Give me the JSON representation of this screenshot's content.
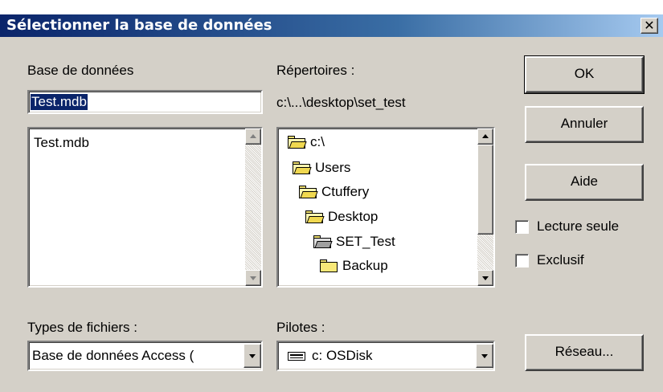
{
  "dialog": {
    "title": "Sélectionner la base de données",
    "close_glyph": "✕"
  },
  "database": {
    "label": "Base de données",
    "value": "Test.mdb",
    "files": [
      "Test.mdb"
    ]
  },
  "directories": {
    "label": "Répertoires :",
    "current_path": "c:\\...\\desktop\\set_test",
    "tree": [
      {
        "name": "c:\\",
        "icon": "open-folder-icon"
      },
      {
        "name": "Users",
        "icon": "open-folder-icon"
      },
      {
        "name": "Ctuffery",
        "icon": "open-folder-icon"
      },
      {
        "name": "Desktop",
        "icon": "open-folder-icon"
      },
      {
        "name": "SET_Test",
        "icon": "open-folder-selected-icon"
      },
      {
        "name": "Backup",
        "icon": "folder-icon"
      }
    ]
  },
  "buttons": {
    "ok": "OK",
    "cancel": "Annuler",
    "help": "Aide",
    "network": "Réseau..."
  },
  "options": {
    "read_only": {
      "label": "Lecture seule",
      "checked": false
    },
    "exclusive": {
      "label": "Exclusif",
      "checked": false
    }
  },
  "file_types": {
    "label": "Types de fichiers :",
    "selected": "Base de données Access ("
  },
  "drives": {
    "label": "Pilotes :",
    "selected": "c: OSDisk",
    "icon": "hard-drive-icon"
  }
}
